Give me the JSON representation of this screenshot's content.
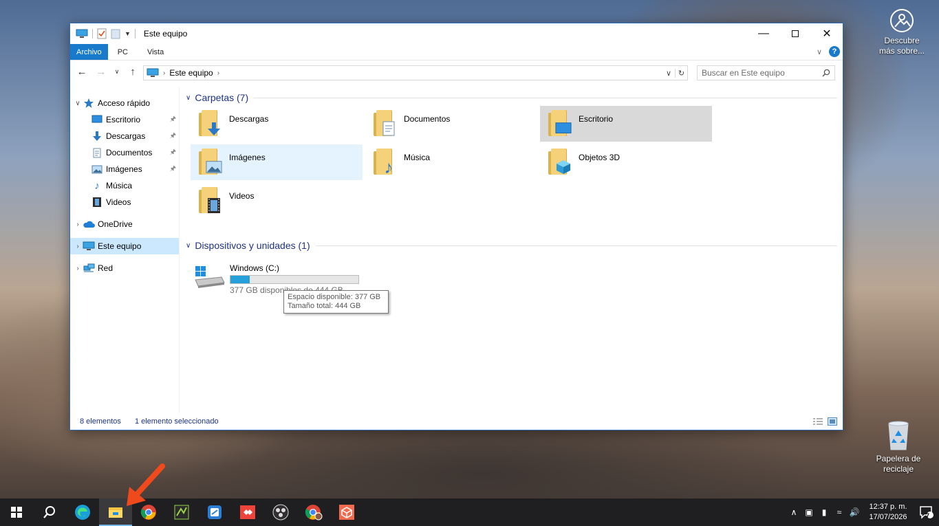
{
  "desktop": {
    "icons": [
      {
        "label": "Descubre\nmás sobre...",
        "icon": "spotlight-camera-icon"
      },
      {
        "label": "Papelera de\nreciclaje",
        "icon": "recycle-bin-icon"
      }
    ]
  },
  "window": {
    "title": "Este equipo",
    "ribbon_tabs": [
      "Archivo",
      "PC",
      "Vista"
    ],
    "help_label": "?",
    "address": {
      "path": "Este equipo"
    },
    "search": {
      "placeholder": "Buscar en Este equipo"
    },
    "sidebar": {
      "quick_access": "Acceso rápido",
      "items": [
        {
          "label": "Escritorio",
          "pinned": true
        },
        {
          "label": "Descargas",
          "pinned": true
        },
        {
          "label": "Documentos",
          "pinned": true
        },
        {
          "label": "Imágenes",
          "pinned": true
        },
        {
          "label": "Música",
          "pinned": false
        },
        {
          "label": "Videos",
          "pinned": false
        }
      ],
      "onedrive": "OneDrive",
      "this_pc": "Este equipo",
      "network": "Red"
    },
    "folders_group": "Carpetas (7)",
    "folders": [
      {
        "label": "Descargas",
        "icon": "download-arrow-icon"
      },
      {
        "label": "Documentos",
        "icon": "document-icon"
      },
      {
        "label": "Escritorio",
        "icon": "desktop-monitor-icon",
        "selected": true
      },
      {
        "label": "Imágenes",
        "icon": "picture-icon",
        "hovered": true
      },
      {
        "label": "Música",
        "icon": "music-note-icon"
      },
      {
        "label": "Objetos 3D",
        "icon": "cube-icon"
      },
      {
        "label": "Videos",
        "icon": "film-icon"
      }
    ],
    "devices_group": "Dispositivos y unidades (1)",
    "drive": {
      "name": "Windows (C:)",
      "free_text": "377 GB disponibles de 444 GB",
      "used_fraction": 0.151
    },
    "tooltip": {
      "line1": "Espacio disponible: 377 GB",
      "line2": "Tamaño total: 444 GB"
    },
    "status": {
      "items": "8 elementos",
      "selected": "1 elemento seleccionado"
    }
  },
  "taskbar": {
    "apps": [
      "start-icon",
      "search-icon",
      "edge-icon",
      "file-explorer-icon",
      "chrome-icon",
      "green-app-icon",
      "blue-app-icon",
      "anydesk-icon",
      "obs-icon",
      "chrome-profile-icon",
      "red-cube-icon"
    ],
    "time": "12:37 p. m.",
    "date": "17/07/2026",
    "notification_count": "7"
  },
  "colors": {
    "accent": "#1979ca",
    "group_header": "#1e3287",
    "drive_fill": "#26a0da",
    "annotation_arrow": "#f04a1c"
  }
}
